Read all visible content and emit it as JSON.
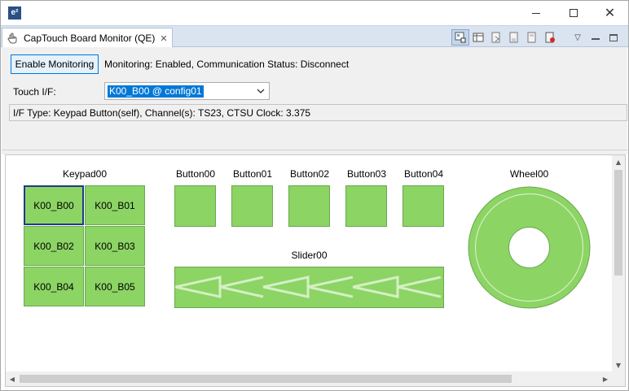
{
  "window": {
    "logo_text": "e²",
    "controls": {
      "minimize_icon": "minimize-icon",
      "maximize_icon": "maximize-icon",
      "close_icon": "close-icon"
    }
  },
  "view_tab": {
    "label": "CapTouch Board Monitor (QE)",
    "icon": "hand-touch-icon",
    "close_glyph": "✕"
  },
  "toolbar": {
    "buttons": [
      "monitor-board-icon",
      "monitor-table-icon",
      "export-icon",
      "save-icon",
      "save-as-icon",
      "stop-record-icon"
    ],
    "view_menu_glyph": "▽"
  },
  "controls": {
    "enable_button": "Enable Monitoring",
    "status": "Monitoring: Enabled, Communication Status: Disconnect",
    "touch_if_label": "Touch I/F:",
    "touch_if_value": "K00_B00 @ config01",
    "info": "I/F Type: Keypad Button(self), Channel(s): TS23, CTSU Clock: 3.375"
  },
  "keypad": {
    "title": "Keypad00",
    "selected": "K00_B00",
    "keys": [
      "K00_B00",
      "K00_B01",
      "K00_B02",
      "K00_B03",
      "K00_B04",
      "K00_B05"
    ]
  },
  "buttons": [
    "Button00",
    "Button01",
    "Button02",
    "Button03",
    "Button04"
  ],
  "slider": {
    "title": "Slider00"
  },
  "wheel": {
    "title": "Wheel00"
  },
  "colors": {
    "sensor_fill": "#8cd464",
    "sensor_border": "#6aa84f",
    "selection": "#1f3a88",
    "accent": "#0078d7",
    "tab_bar": "#dae4f1"
  }
}
